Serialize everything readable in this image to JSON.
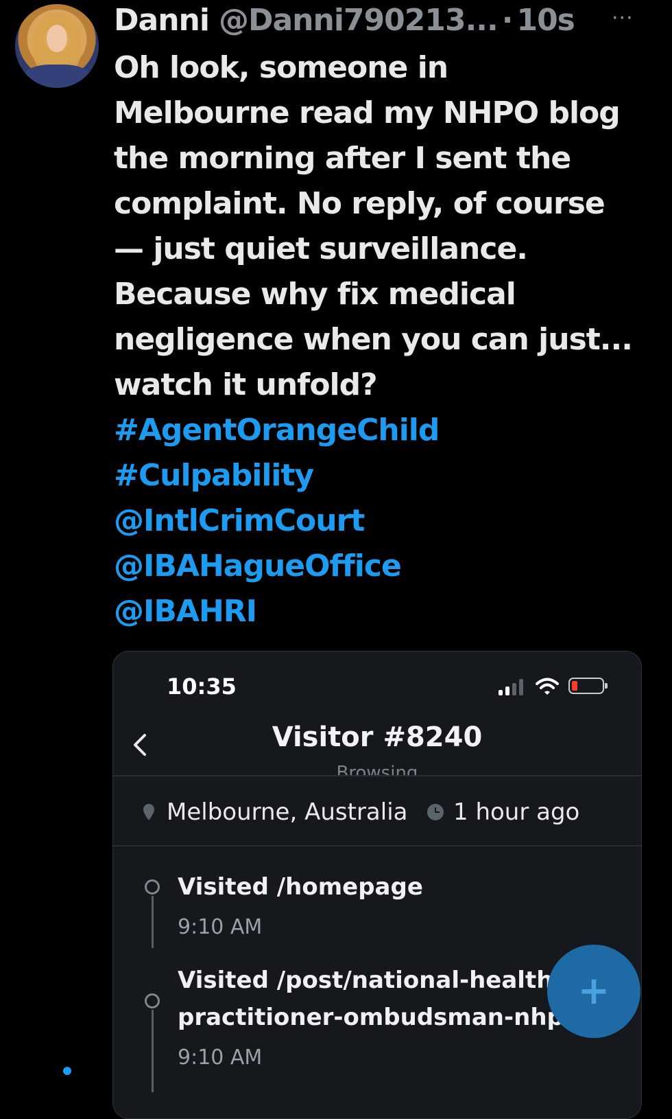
{
  "tweet": {
    "author_name": "Danni",
    "handle": "@Danni790213...",
    "separator": "·",
    "time": "10s",
    "more_icon": "more-horizontal-icon",
    "body_lines": [
      "Oh look, someone in",
      "Melbourne read my NHPO blog",
      "the morning after I sent the",
      "complaint. No reply, of course",
      "— just quiet surveillance.",
      "Because why fix medical",
      "negligence when you can just...",
      "watch it unfold?"
    ],
    "links": [
      "#AgentOrangeChild",
      "#Culpability",
      "@IntlCrimCourt",
      "@IBAHagueOffice",
      "@IBAHRI"
    ],
    "link_color": "#1d9bf0"
  },
  "screenshot": {
    "status_bar": {
      "time": "10:35"
    },
    "nav": {
      "back_icon": "chevron-left-icon",
      "title": "Visitor #8240",
      "subtitle": "Browsing"
    },
    "meta": {
      "location_icon": "map-pin-icon",
      "location": "Melbourne, Australia",
      "time_icon": "clock-icon",
      "last_seen": "1 hour ago"
    },
    "timeline": [
      {
        "title": "Visited /homepage",
        "time": "9:10 AM"
      },
      {
        "title_lines": [
          "Visited /post/national-health-",
          "practitioner-ombudsman-nhpo"
        ],
        "time": "9:10 AM"
      }
    ],
    "fab": {
      "icon": "plus-icon",
      "label": "+"
    }
  }
}
